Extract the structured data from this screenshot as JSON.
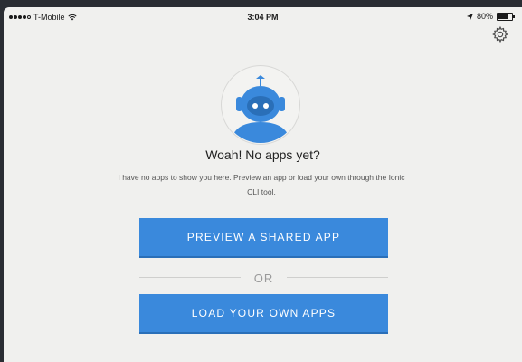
{
  "status_bar": {
    "carrier": "T-Mobile",
    "time": "3:04 PM",
    "battery": "80%",
    "battery_level": 0.8
  },
  "icons": {
    "settings": "gear-icon",
    "avatar": "robot-avatar-icon",
    "wifi": "wifi-icon",
    "location": "location-arrow-icon",
    "battery": "battery-icon"
  },
  "empty_state": {
    "heading": "Woah! No apps yet?",
    "description": "I have no apps to show you here. Preview an app or load your own through the Ionic CLI tool."
  },
  "actions": {
    "preview_label": "PREVIEW A SHARED APP",
    "divider_label": "OR",
    "load_label": "LOAD YOUR OWN APPS"
  },
  "colors": {
    "accent": "#3a89dc",
    "background": "#f0f0ee"
  }
}
